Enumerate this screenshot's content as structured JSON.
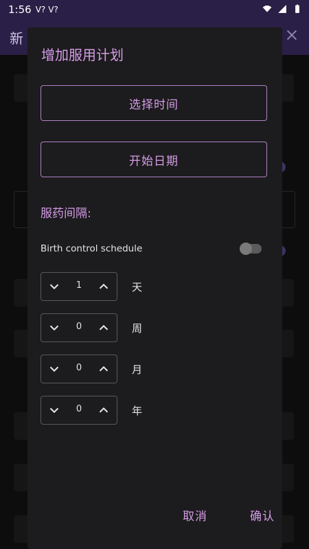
{
  "status_bar": {
    "time": "1:56",
    "left_icons": [
      "V?",
      "V?"
    ]
  },
  "appbar": {
    "title": "新"
  },
  "dialog": {
    "title": "增加服用计划",
    "select_time_label": "选择时间",
    "start_date_label": "开始日期",
    "interval_label": "服药间隔:",
    "birth_control_label": "Birth control schedule",
    "birth_control_on": false,
    "intervals": [
      {
        "value": "1",
        "unit": "天"
      },
      {
        "value": "0",
        "unit": "周"
      },
      {
        "value": "0",
        "unit": "月"
      },
      {
        "value": "0",
        "unit": "年"
      }
    ],
    "cancel_label": "取消",
    "confirm_label": "确认"
  },
  "colors": {
    "accent": "#d59ce8",
    "dialog_bg": "#1c1b1d",
    "appbar_bg": "#2a1f46"
  }
}
